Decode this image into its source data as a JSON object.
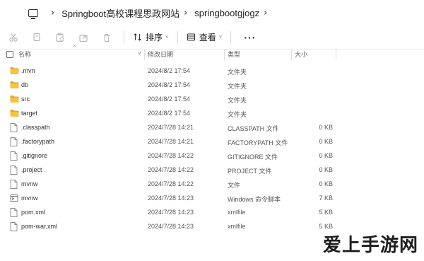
{
  "breadcrumb": {
    "items": [
      "Springboot高校课程思政网站",
      "springbootgjogz"
    ]
  },
  "toolbar": {
    "sort_label": "排序",
    "view_label": "查看",
    "more_label": "···"
  },
  "columns": {
    "name": "名称",
    "date": "修改日期",
    "type": "类型",
    "size": "大小"
  },
  "files": [
    {
      "name": ".mvn",
      "date": "2024/8/2 17:54",
      "type": "文件夹",
      "size": "",
      "kind": "folder"
    },
    {
      "name": "db",
      "date": "2024/8/2 17:54",
      "type": "文件夹",
      "size": "",
      "kind": "folder"
    },
    {
      "name": "src",
      "date": "2024/8/2 17:54",
      "type": "文件夹",
      "size": "",
      "kind": "folder"
    },
    {
      "name": "target",
      "date": "2024/8/2 17:54",
      "type": "文件夹",
      "size": "",
      "kind": "folder"
    },
    {
      "name": ".classpath",
      "date": "2024/7/28 14:21",
      "type": "CLASSPATH 文件",
      "size": "0 KB",
      "kind": "file"
    },
    {
      "name": ".factorypath",
      "date": "2024/7/28 14:21",
      "type": "FACTORYPATH 文件",
      "size": "0 KB",
      "kind": "file"
    },
    {
      "name": ".gitignore",
      "date": "2024/7/28 14:22",
      "type": "GITIGNORE 文件",
      "size": "0 KB",
      "kind": "file"
    },
    {
      "name": ".project",
      "date": "2024/7/28 14:22",
      "type": "PROJECT 文件",
      "size": "0 KB",
      "kind": "file"
    },
    {
      "name": "mvnw",
      "date": "2024/7/28 14:22",
      "type": "文件",
      "size": "0 KB",
      "kind": "file"
    },
    {
      "name": "mvnw",
      "date": "2024/7/28 14:23",
      "type": "Windows 命令脚本",
      "size": "7 KB",
      "kind": "script"
    },
    {
      "name": "pom.xml",
      "date": "2024/7/28 14:23",
      "type": "xmlfile",
      "size": "5 KB",
      "kind": "file"
    },
    {
      "name": "pom-war.xml",
      "date": "2024/7/28 14:23",
      "type": "xmlfile",
      "size": "5 KB",
      "kind": "file"
    }
  ],
  "watermark": "爱上手游网",
  "colors": {
    "folder": "#f5c342",
    "folder_dark": "#e0a92a",
    "icon_gray": "#b8b8b8"
  }
}
